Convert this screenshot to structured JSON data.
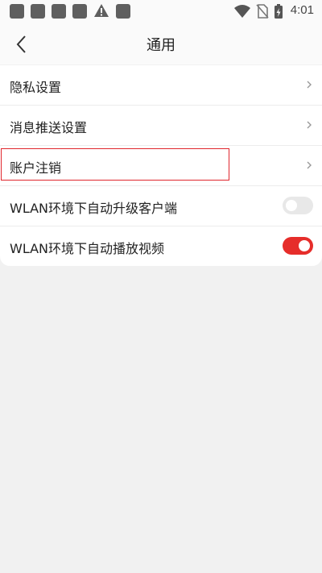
{
  "status_bar": {
    "time": "4:01",
    "icons": [
      "notification-icon",
      "notification-icon",
      "notification-icon",
      "notification-icon",
      "warning-icon",
      "notification-icon",
      "wifi-icon",
      "no-sim-icon",
      "battery-charging-icon"
    ]
  },
  "header": {
    "title": "通用",
    "back_icon": "chevron-left-icon"
  },
  "settings": {
    "items": [
      {
        "label": "隐私设置",
        "type": "link"
      },
      {
        "label": "消息推送设置",
        "type": "link"
      },
      {
        "label": "账户注销",
        "type": "link"
      },
      {
        "label": "WLAN环境下自动升级客户端",
        "type": "toggle",
        "on": false
      },
      {
        "label": "WLAN环境下自动播放视频",
        "type": "toggle",
        "on": true
      }
    ]
  },
  "colors": {
    "accent": "#e62d2a",
    "highlight_border": "#e0262d",
    "background": "#f1f1f1"
  }
}
